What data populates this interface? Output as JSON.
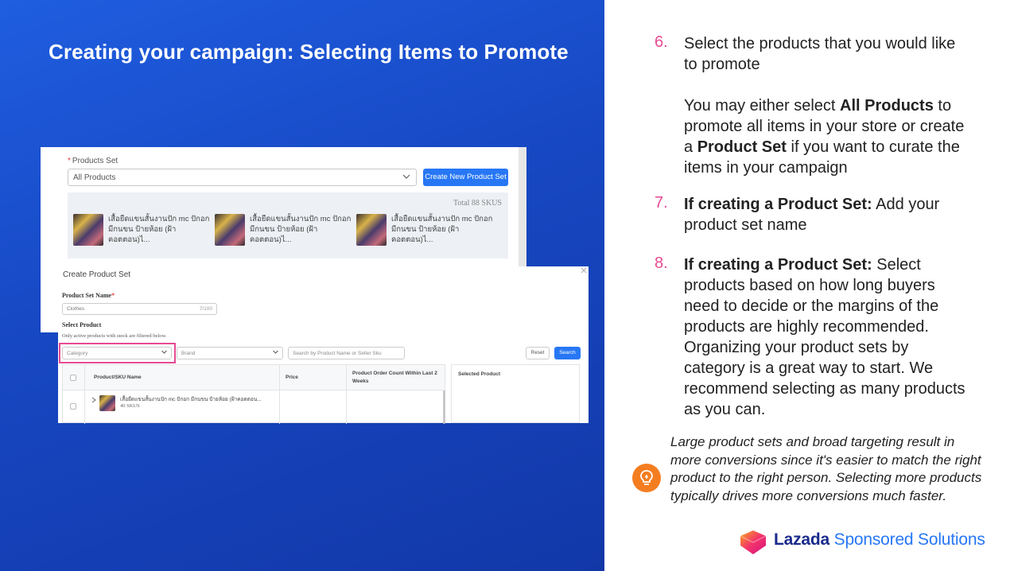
{
  "slide": {
    "title": "Creating your campaign: Selecting Items to Promote"
  },
  "products_set_panel": {
    "label": "Products Set",
    "selected": "All Products",
    "create_button": "Create New Product Set",
    "total": "Total 88 SKUS",
    "products": [
      {
        "name": "เสื้อยืดแขนสั้นงานปัก mc ปักอก มีกนขน ป้ายห้อย (ฝ้าคอตตอน)ไ..."
      },
      {
        "name": "เสื้อยืดแขนสั้นงานปัก mc ปักอก มีกนขน ป้ายห้อย (ฝ้าคอตตอน)ไ..."
      },
      {
        "name": "เสื้อยืดแขนสั้นงานปัก mc ปักอก มีกนขน ป้ายห้อย (ฝ้าคอตตอน)ไ..."
      }
    ]
  },
  "create_dialog": {
    "title": "Create Product Set",
    "name_label": "Product Set Name",
    "name_value": "Clothes",
    "name_count": "7/100",
    "select_label": "Select Product",
    "note": "Only active products with stock are filtered below.",
    "category_placeholder": "Category",
    "brand_placeholder": "Brand",
    "search_placeholder": "Search by Product Name or Seller Sku",
    "reset_button": "Reset",
    "search_button": "Search",
    "columns": {
      "name": "Product/SKU Name",
      "price": "Price",
      "order_count": "Product Order Count Within Last 2 Weeks"
    },
    "selected_header": "Selected Product",
    "rows": [
      {
        "name": "เสื้อยืดแขนสั้นงานปัก mc ปักอก มีกนขน ป้ายห้อย (ฝ้าคอตตอน...",
        "skus": "40 SKUS"
      }
    ]
  },
  "steps": [
    {
      "num": "6.",
      "lines": [
        "Select the products that you would like to promote"
      ],
      "para2_pre": "You may either select ",
      "para2_b1": "All Products",
      "para2_mid": " to promote all items in your store or create a ",
      "para2_b2": "Product Set",
      "para2_post": " if you want to curate the items in your campaign"
    },
    {
      "num": "7.",
      "bold": "If creating a Product Set:",
      "rest": " Add your product set name"
    },
    {
      "num": "8.",
      "bold": "If creating a Product Set:",
      "rest": " Select products based on how long buyers need to decide or the margins of the products are highly recommended. Organizing your product sets by category is a great way to start. We recommend selecting as many products as you can."
    }
  ],
  "tip": {
    "icon": "lightbulb-icon",
    "text": "Large product sets and broad targeting result in more conversions since it's easier to match the right product to the right person. Selecting more products typically drives more conversions much faster."
  },
  "brand": {
    "name_part1": "Lazada ",
    "name_part2": "Sponsored Solutions",
    "accent": "#e64a93",
    "primary": "#2777f5"
  }
}
